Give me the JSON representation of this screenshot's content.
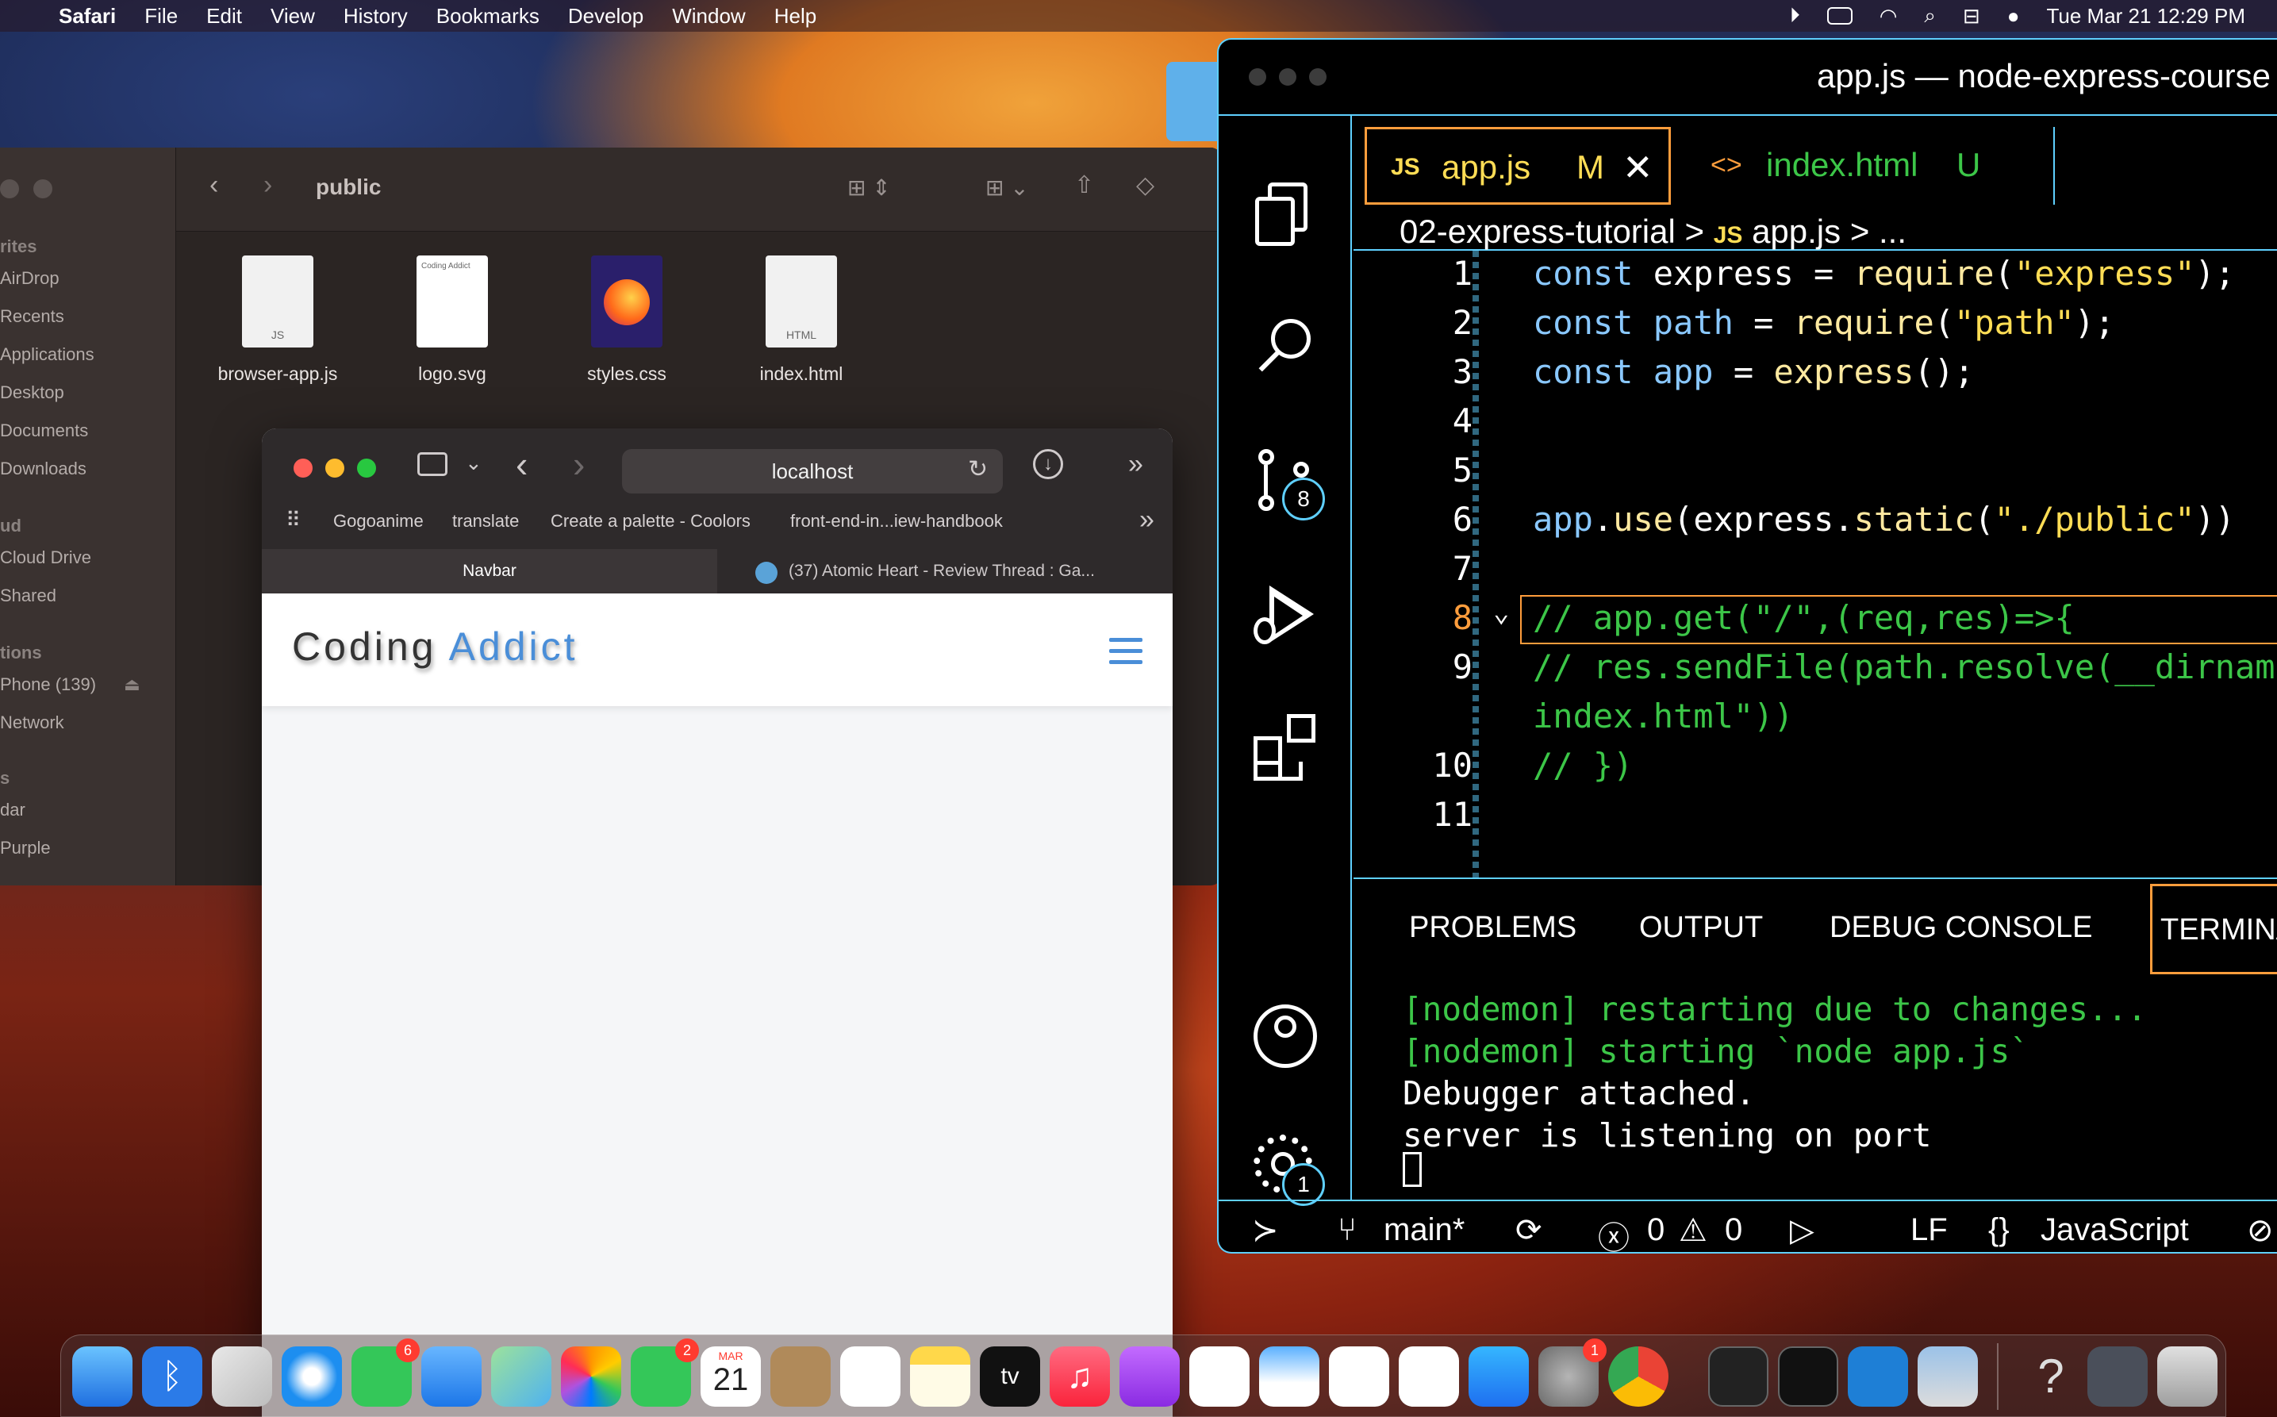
{
  "menubar": {
    "app": "Safari",
    "items": [
      "File",
      "Edit",
      "View",
      "History",
      "Bookmarks",
      "Develop",
      "Window",
      "Help"
    ],
    "datetime": "Tue Mar 21  12:29 PM"
  },
  "finder": {
    "folder": "public",
    "sidebar": {
      "favorites_head": "rites",
      "favorites": [
        "AirDrop",
        "Recents",
        "Applications",
        "Desktop",
        "Documents",
        "Downloads"
      ],
      "icloud_head": "ud",
      "icloud": [
        "Cloud Drive",
        "Shared"
      ],
      "locations_head": "tions",
      "locations": [
        "Phone (139)",
        "Network"
      ],
      "tags_head": "s",
      "tags": [
        "dar",
        "Purple"
      ]
    },
    "files": [
      {
        "name": "browser-app.js",
        "tag": "JS"
      },
      {
        "name": "logo.svg",
        "tag": "Coding Addict"
      },
      {
        "name": "styles.css",
        "tag": ""
      },
      {
        "name": "index.html",
        "tag": "HTML"
      }
    ]
  },
  "safari": {
    "url": "localhost",
    "bookmarks": [
      "Gogoanime",
      "translate",
      "Create a palette - Coolors",
      "front-end-in...iew-handbook"
    ],
    "tabs": [
      "Navbar",
      "(37) Atomic Heart - Review Thread : Ga..."
    ],
    "page": {
      "brand_first": "Coding",
      "brand_second": "Addict"
    }
  },
  "vscode": {
    "title": "app.js — node-express-course",
    "tabs": [
      {
        "icon": "JS",
        "label": "app.js",
        "status": "M"
      },
      {
        "icon": "<>",
        "label": "index.html",
        "status": "U"
      }
    ],
    "breadcrumb": {
      "folder": "02-express-tutorial",
      "sep": ">",
      "icon": "JS",
      "file": "app.js",
      "tail": "> ..."
    },
    "badges": {
      "scm": "8",
      "settings": "1"
    },
    "code": [
      {
        "ln": "1",
        "tokens": [
          [
            "kw",
            "const"
          ],
          [
            "t",
            " express = "
          ],
          [
            "fn",
            "require"
          ],
          [
            "t",
            "("
          ],
          [
            "str",
            "\"express\""
          ],
          [
            "t",
            ");"
          ]
        ]
      },
      {
        "ln": "2",
        "tokens": [
          [
            "kw",
            "const"
          ],
          [
            "t",
            " "
          ],
          [
            "kw",
            "path"
          ],
          [
            "t",
            " = "
          ],
          [
            "fn",
            "require"
          ],
          [
            "t",
            "("
          ],
          [
            "str",
            "\"path\""
          ],
          [
            "t",
            ");"
          ]
        ]
      },
      {
        "ln": "3",
        "tokens": [
          [
            "kw",
            "const"
          ],
          [
            "t",
            " "
          ],
          [
            "kw",
            "app"
          ],
          [
            "t",
            " = "
          ],
          [
            "fn",
            "express"
          ],
          [
            "t",
            "();"
          ]
        ]
      },
      {
        "ln": "4",
        "tokens": []
      },
      {
        "ln": "5",
        "tokens": []
      },
      {
        "ln": "6",
        "tokens": [
          [
            "kw",
            "app"
          ],
          [
            "t",
            "."
          ],
          [
            "fn",
            "use"
          ],
          [
            "t",
            "("
          ],
          [
            "t",
            "express."
          ],
          [
            "fn",
            "static"
          ],
          [
            "t",
            "("
          ],
          [
            "str",
            "\"./public\""
          ],
          [
            "t",
            "))"
          ]
        ]
      },
      {
        "ln": "7",
        "tokens": []
      },
      {
        "ln": "8",
        "tokens": [
          [
            "cm",
            "// app.get(\"/\",(req,res)=>{"
          ]
        ]
      },
      {
        "ln": "9",
        "tokens": [
          [
            "cm",
            "// res.sendFile(path.resolve(__dirname"
          ]
        ]
      },
      {
        "ln": "",
        "tokens": [
          [
            "cm",
            "index.html\"))"
          ]
        ]
      },
      {
        "ln": "10",
        "tokens": [
          [
            "cm",
            "// })"
          ]
        ]
      },
      {
        "ln": "11",
        "tokens": []
      }
    ],
    "panel_tabs": [
      "PROBLEMS",
      "OUTPUT",
      "DEBUG CONSOLE",
      "TERMINA"
    ],
    "terminal": [
      {
        "text": "[nodemon] restarting due to changes...",
        "color": "#3cc648"
      },
      {
        "text": "[nodemon] starting `node app.js`",
        "color": "#3cc648"
      },
      {
        "text": "Debugger attached.",
        "color": "#ffffff"
      },
      {
        "text": "server is listening on port",
        "color": "#ffffff"
      }
    ],
    "status": {
      "branch": "main*",
      "errors": "0",
      "warnings": "0",
      "eol": "LF",
      "language": "JavaScript"
    }
  },
  "dock": {
    "badges": {
      "messages": "6",
      "facetime": "2",
      "settings": "1"
    },
    "calendar": {
      "month": "MAR",
      "day": "21"
    },
    "tv": "tv"
  },
  "colors": {
    "accent": "#5fd0ff",
    "active_tab": "#ff9d3c",
    "comment": "#3cc648",
    "string": "#ffdd55",
    "brand_blue": "#4a8ed8"
  }
}
